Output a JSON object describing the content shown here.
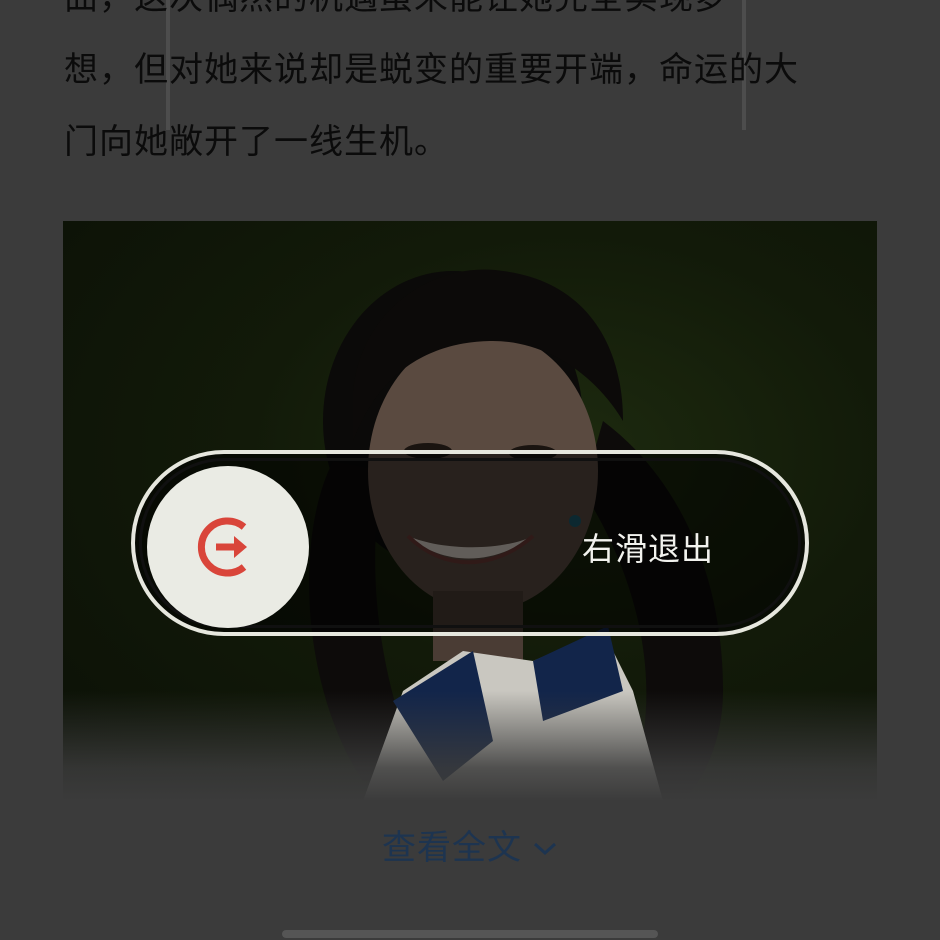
{
  "article": {
    "lines": [
      "曲，这次偶然的机遇虽未能让她完全实现梦",
      "想，但对她来说却是蜕变的重要开端，命运的大",
      "门向她敞开了一线生机。"
    ]
  },
  "photo": {
    "alt": ""
  },
  "exit_slider": {
    "label": "右滑退出",
    "icon": "exit-arrow-icon",
    "icon_color": "#d9453a"
  },
  "footer": {
    "view_full_label": "查看全文",
    "link_color": "#1d3450"
  }
}
